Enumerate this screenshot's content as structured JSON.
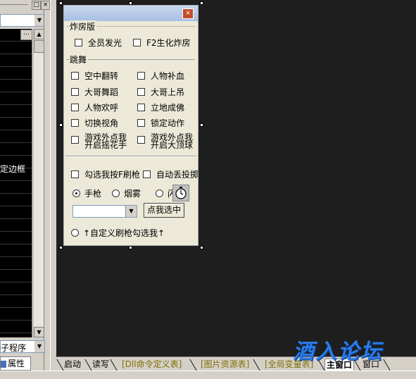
{
  "left_panel": {
    "grid_text": "定边框",
    "combo_text": "子程序",
    "tab_label": "属性",
    "window_buttons": [
      "□",
      "×"
    ]
  },
  "form": {
    "close_glyph": "×",
    "group1": {
      "title": "炸房版",
      "items": [
        "全员发光",
        "F2生化炸房"
      ]
    },
    "group2": {
      "title": "跳舞",
      "items": [
        "空中翻转",
        "人物补血",
        "大哥舞蹈",
        "大哥上吊",
        "人物欢呼",
        "立地成佛",
        "切换视角",
        "锁定动作"
      ],
      "two_line_items": [
        [
          "游戏外点我",
          "开启摇花手"
        ],
        [
          "游戏外点我",
          "开启大顶球"
        ]
      ]
    },
    "group3": {
      "checks": [
        "勾选我按F刷枪",
        "自动丢投掷"
      ],
      "radios": [
        {
          "label": "手枪",
          "selected": true
        },
        {
          "label": "烟雾",
          "selected": false
        },
        {
          "label": "闪",
          "selected": false
        }
      ],
      "dropdown_value": "",
      "pick_button": "点我选中",
      "custom_radio": "↑自定义刷枪勾选我↑"
    }
  },
  "tabs": [
    {
      "label": "启动",
      "style": "normal"
    },
    {
      "label": "读写",
      "style": "normal"
    },
    {
      "label": "[Dll命令定义表]",
      "style": "gold"
    },
    {
      "label": "[图片资源表]",
      "style": "gold"
    },
    {
      "label": "[全局变量表]",
      "style": "gold"
    },
    {
      "label": "主窗口",
      "style": "active"
    },
    {
      "label": "窗口",
      "style": "normal"
    }
  ],
  "watermark": "酒入论坛"
}
